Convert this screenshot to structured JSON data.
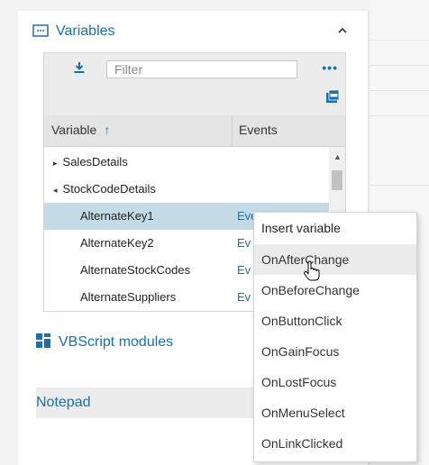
{
  "variables_section": {
    "title": "Variables",
    "collapse_icon": "chevron-up-icon"
  },
  "toolbar": {
    "filter_placeholder": "Filter",
    "more_label": "•••"
  },
  "columns": {
    "variable": "Variable",
    "sort_icon": "↑",
    "events": "Events"
  },
  "rows": [
    {
      "label": "SalesDetails",
      "expander": "▸",
      "events": ""
    },
    {
      "label": "StockCodeDetails",
      "expander": "◂",
      "events": ""
    },
    {
      "label": "AlternateKey1",
      "events": "Events",
      "selected": true
    },
    {
      "label": "AlternateKey2",
      "events": "Ev"
    },
    {
      "label": "AlternateStockCodes",
      "events": "Ev"
    },
    {
      "label": "AlternateSuppliers",
      "events": "Ev"
    }
  ],
  "vbscript": {
    "title": "VBScript modules"
  },
  "notepad": {
    "title": "Notepad"
  },
  "context_menu": {
    "header": "Insert variable",
    "items": [
      "OnAfterChange",
      "OnBeforeChange",
      "OnButtonClick",
      "OnGainFocus",
      "OnLostFocus",
      "OnMenuSelect",
      "OnLinkClicked"
    ],
    "hovered": "OnAfterChange"
  },
  "colors": {
    "accent": "#1c6fa8",
    "selected_row": "#c3dbe6",
    "panel_bg": "#ececec"
  }
}
